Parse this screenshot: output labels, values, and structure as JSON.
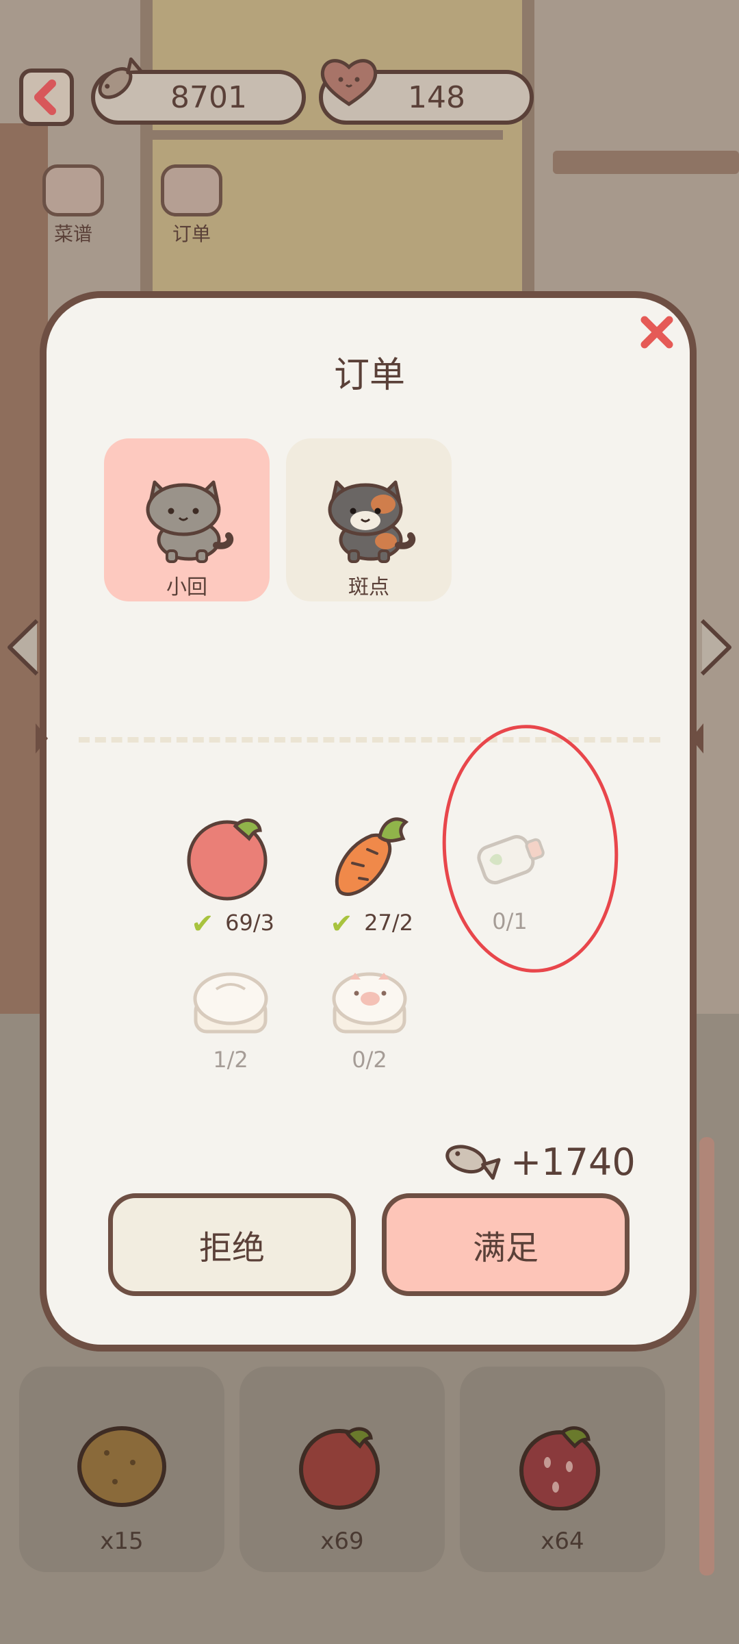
{
  "top_bar": {
    "back_icon": "chevron-left-icon",
    "fish_currency": "8701",
    "heart_currency": "148"
  },
  "tools": [
    {
      "label": "菜谱",
      "icon": "chef-hat-icon"
    },
    {
      "label": "订单",
      "icon": "cat-utensils-icon"
    }
  ],
  "dialog": {
    "title": "订单",
    "close_icon": "close-icon",
    "customers": [
      {
        "name": "小回",
        "selected": true,
        "icon": "grey-tabby-cat-icon"
      },
      {
        "name": "斑点",
        "selected": false,
        "icon": "calico-cat-icon"
      }
    ],
    "requirements": [
      {
        "item": "tomato",
        "icon": "tomato-icon",
        "count": "69/3",
        "fulfilled": true
      },
      {
        "item": "carrot",
        "icon": "carrot-icon",
        "count": "27/2",
        "fulfilled": true
      },
      {
        "item": "bottle",
        "icon": "bottle-icon",
        "count": "0/1",
        "fulfilled": false
      },
      {
        "item": "steamed-bun",
        "icon": "steamed-bun-icon",
        "count": "1/2",
        "fulfilled": false
      },
      {
        "item": "pig-bun",
        "icon": "pig-bun-icon",
        "count": "0/2",
        "fulfilled": false
      }
    ],
    "reward": "+1740",
    "reject_label": "拒绝",
    "accept_label": "满足"
  },
  "inventory": [
    {
      "icon": "potato-icon",
      "count": "x15"
    },
    {
      "icon": "tomato-icon",
      "count": "x69"
    },
    {
      "icon": "strawberry-icon",
      "count": "x64"
    }
  ],
  "colors": {
    "selected_card": "#fdc9bf",
    "unselected_card": "#f1ebde",
    "accept_button": "#fdc5b8",
    "reject_button": "#f2ede0",
    "check": "#a8c33e",
    "annotation": "#e8464b"
  }
}
